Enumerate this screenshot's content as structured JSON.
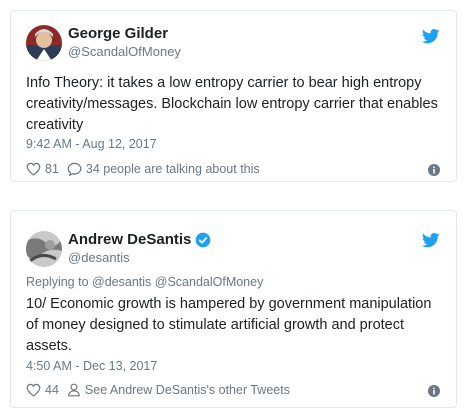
{
  "colors": {
    "twitter_blue": "#1da1f2",
    "text_primary": "#1c2022",
    "text_secondary": "#697882",
    "border": "#e1e8ed"
  },
  "tweets": [
    {
      "author_name": "George Gilder",
      "handle": "@ScandalOfMoney",
      "verified": false,
      "body": "Info Theory: it takes a low entropy carrier to bear high entropy creativity/messages. Blockchain low entropy carrier that enables creativity",
      "timestamp": "9:42 AM - Aug 12, 2017",
      "like_count": "81",
      "talking": "34 people are talking about this"
    },
    {
      "author_name": "Andrew DeSantis",
      "handle": "@desantis",
      "verified": true,
      "reply_prefix": "Replying to",
      "reply_to_1": "@desantis",
      "reply_to_2": "@ScandalOfMoney",
      "body": "10/ Economic growth is hampered by government manipulation of money designed to stimulate artificial growth and protect assets.",
      "timestamp": "4:50 AM - Dec 13, 2017",
      "like_count": "44",
      "other_tweets": "See Andrew DeSantis's other Tweets"
    }
  ],
  "icons": {
    "bird": "twitter-bird-icon",
    "heart": "heart-icon",
    "comment": "comment-icon",
    "person": "person-icon",
    "info": "info-icon",
    "verified": "verified-badge-icon"
  }
}
